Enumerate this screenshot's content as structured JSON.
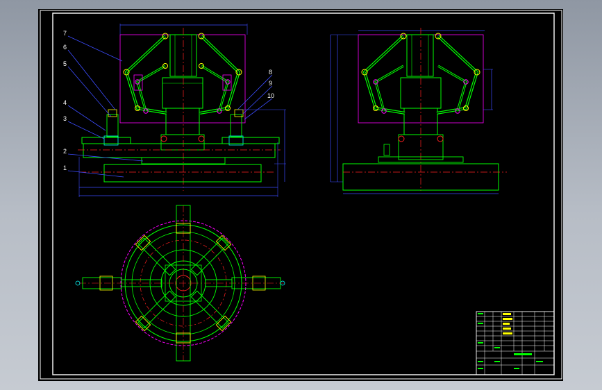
{
  "drawing": {
    "part_labels": [
      "7",
      "6",
      "5",
      "4",
      "3",
      "2",
      "1",
      "8",
      "9",
      "10"
    ],
    "colors": {
      "frame": "#ffffff",
      "outline": "#00ff00",
      "center_line": "#ff2020",
      "dimension": "#3c4cff",
      "magenta": "#ff00ff",
      "cyan": "#00ffff",
      "yellow": "#ffff00"
    }
  }
}
